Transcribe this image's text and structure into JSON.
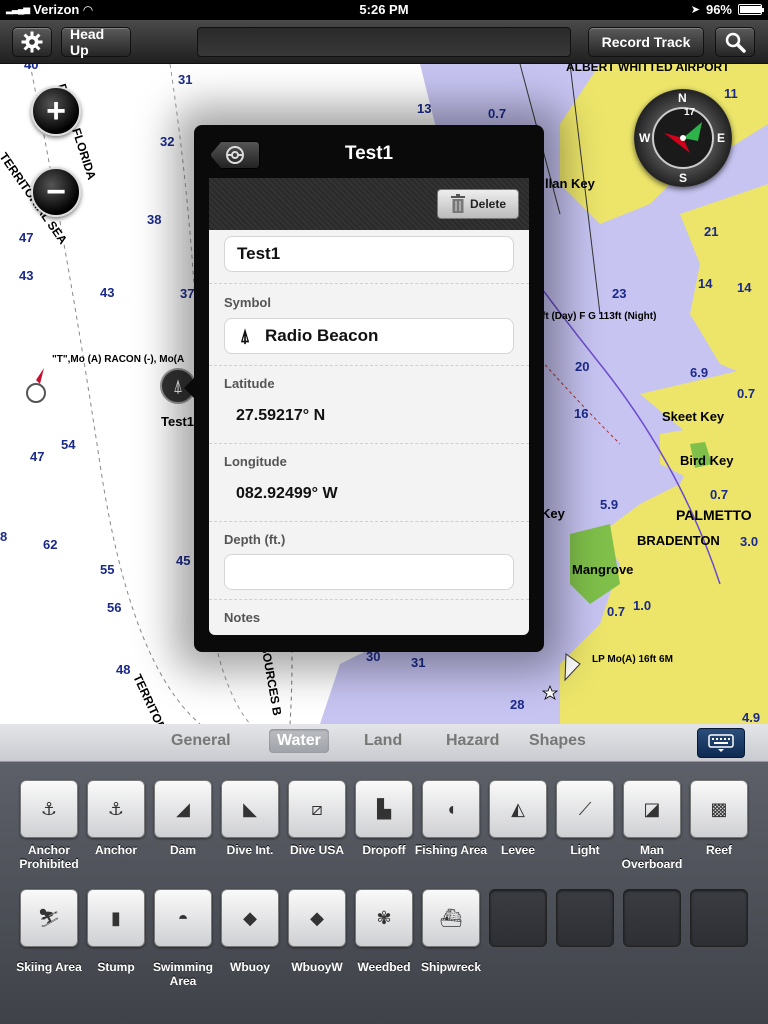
{
  "status": {
    "carrier": "Verizon",
    "time": "5:26 PM",
    "battery": "96%",
    "battery_level": 0.96
  },
  "toolbar": {
    "head_up": "Head Up",
    "record_track": "Record Track",
    "settings_icon": "gear-icon",
    "search_icon": "search-icon"
  },
  "map": {
    "zoom_in": "+",
    "zoom_out": "−",
    "labels": {
      "airport": "ALBERT WHITTED AIRPORT",
      "boundary": "DARY – FLORIDA",
      "territorial": "TERRITORIAL SEA",
      "territorial2": "TERRITORI",
      "sources": "SOURCES B",
      "racon": "\"T\",Mo (A) RACON (-), Mo(A",
      "light_key": "llan Key",
      "day_light": "ft (Day) F G 113ft (Night)",
      "skeet": "Skeet Key",
      "bird": "Bird Key",
      "palmetto": "PALMETTO",
      "bradenton": "BRADENTON",
      "mangrove": "Mangrove",
      "lp": "LP Mo(A) 16ft 6M",
      "key": "Key",
      "waypoint": "Test1"
    },
    "depths": [
      "31",
      "32",
      "38",
      "47",
      "43",
      "43",
      "37",
      "13",
      "0.7",
      "11",
      "21",
      "14",
      "14",
      "23",
      "6.9",
      "20",
      "16",
      "0.7",
      "5.9",
      "0.7",
      "3.0",
      "0.7",
      "1.0",
      "47",
      "54",
      "62",
      "55",
      "56",
      "45",
      "48",
      "30",
      "31",
      "28",
      "4.9",
      "40",
      "8"
    ],
    "compass": {
      "n": "N",
      "s": "S",
      "e": "E",
      "w": "W",
      "heading": "17"
    }
  },
  "popup": {
    "title": "Test1",
    "delete_label": "Delete",
    "name_value": "Test1",
    "symbol_label": "Symbol",
    "symbol_value": "Radio Beacon",
    "latitude_label": "Latitude",
    "latitude_value": "27.59217° N",
    "longitude_label": "Longitude",
    "longitude_value": "082.92499° W",
    "depth_label": "Depth (ft.)",
    "depth_value": "",
    "notes_label": "Notes"
  },
  "tabs": [
    {
      "label": "General"
    },
    {
      "label": "Water"
    },
    {
      "label": "Land"
    },
    {
      "label": "Hazard"
    },
    {
      "label": "Shapes"
    }
  ],
  "active_tab": "Water",
  "symbols_row1": [
    {
      "label": "Anchor Prohibited",
      "icon": "anchor-prohibited-icon",
      "glyph": "⚓"
    },
    {
      "label": "Anchor",
      "icon": "anchor-icon",
      "glyph": "⚓"
    },
    {
      "label": "Dam",
      "icon": "dam-icon",
      "glyph": "◢"
    },
    {
      "label": "Dive Int.",
      "icon": "dive-int-icon",
      "glyph": "◣"
    },
    {
      "label": "Dive USA",
      "icon": "dive-usa-icon",
      "glyph": "⧄"
    },
    {
      "label": "Dropoff",
      "icon": "dropoff-icon",
      "glyph": "▙"
    },
    {
      "label": "Fishing Area",
      "icon": "fish-icon",
      "glyph": "◖"
    },
    {
      "label": "Levee",
      "icon": "levee-icon",
      "glyph": "◭"
    },
    {
      "label": "Light",
      "icon": "light-icon",
      "glyph": "⟋"
    },
    {
      "label": "Man Overboard",
      "icon": "man-overboard-icon",
      "glyph": "◪"
    },
    {
      "label": "Reef",
      "icon": "reef-icon",
      "glyph": "▩"
    }
  ],
  "symbols_row2": [
    {
      "label": "Skiing Area",
      "icon": "skiing-icon",
      "glyph": "⛷"
    },
    {
      "label": "Stump",
      "icon": "stump-icon",
      "glyph": "▮"
    },
    {
      "label": "Swimming Area",
      "icon": "swimming-icon",
      "glyph": "◓"
    },
    {
      "label": "Wbuoy",
      "icon": "wbuoy-icon",
      "glyph": "◆"
    },
    {
      "label": "WbuoyW",
      "icon": "wbuoyw-icon",
      "glyph": "◆"
    },
    {
      "label": "Weedbed",
      "icon": "weedbed-icon",
      "glyph": "✾"
    },
    {
      "label": "Shipwreck",
      "icon": "shipwreck-icon",
      "glyph": "⛴"
    }
  ]
}
